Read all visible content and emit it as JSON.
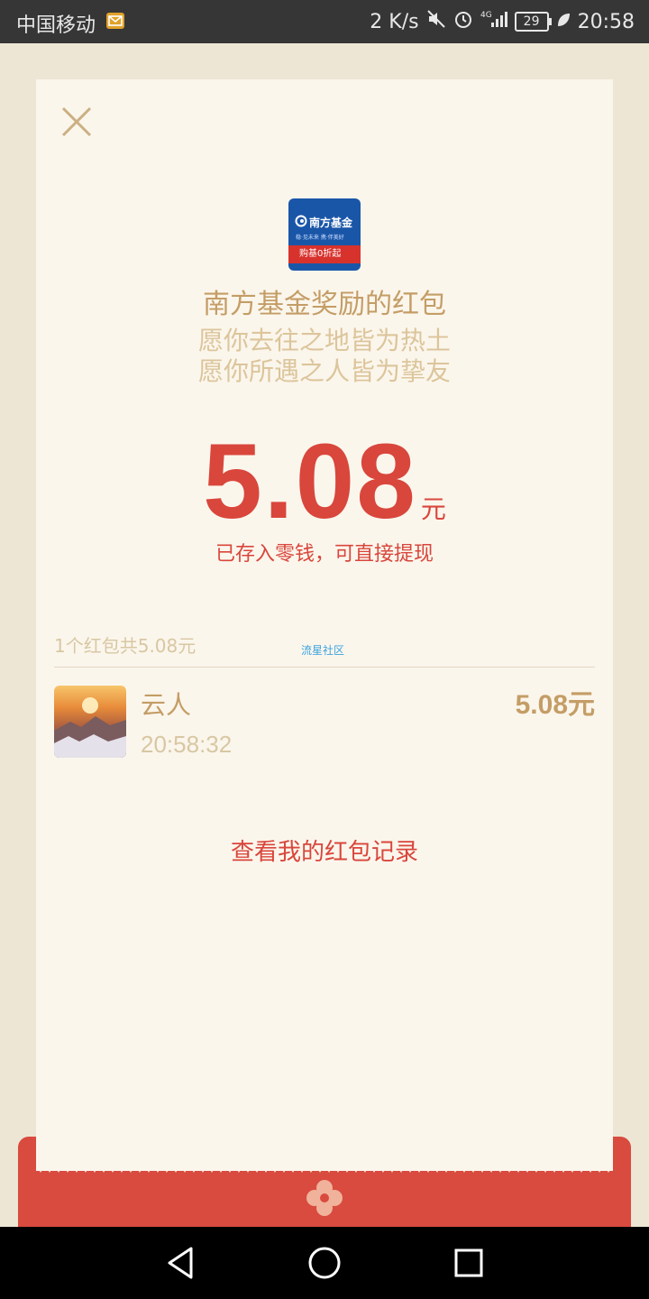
{
  "status_bar": {
    "carrier": "中国移动",
    "speed": "2 K/s",
    "network": "4G",
    "battery": "29",
    "time": "20:58"
  },
  "card": {
    "sender_title": "南方基金奖励的红包",
    "blessing_line1": "愿你去往之地皆为热土",
    "blessing_line2": "愿你所遇之人皆为挚友",
    "amount": "5.08",
    "unit": "元",
    "stored_note": "已存入零钱，可直接提现",
    "summary": "1个红包共5.08元",
    "watermark": "流星社区",
    "logo": {
      "brand": "南方基金",
      "slogan": "稳·见未来  携·伴美好",
      "band": "购基0折起"
    },
    "receiver": {
      "name": "云人",
      "time": "20:58:32",
      "amount": "5.08元"
    },
    "history_link": "查看我的红包记录"
  },
  "colors": {
    "accent_red": "#d9463c",
    "gold_text": "#c49d66",
    "card_bg": "#fbf6ec",
    "page_bg": "#ede6d5"
  },
  "icons": {
    "close": "close-icon",
    "mute": "mute-icon",
    "alarm": "alarm-icon",
    "signal": "signal-icon",
    "battery": "battery-icon",
    "leaf": "leaf-icon",
    "back": "back-icon",
    "home": "home-icon",
    "recents": "recents-icon"
  }
}
